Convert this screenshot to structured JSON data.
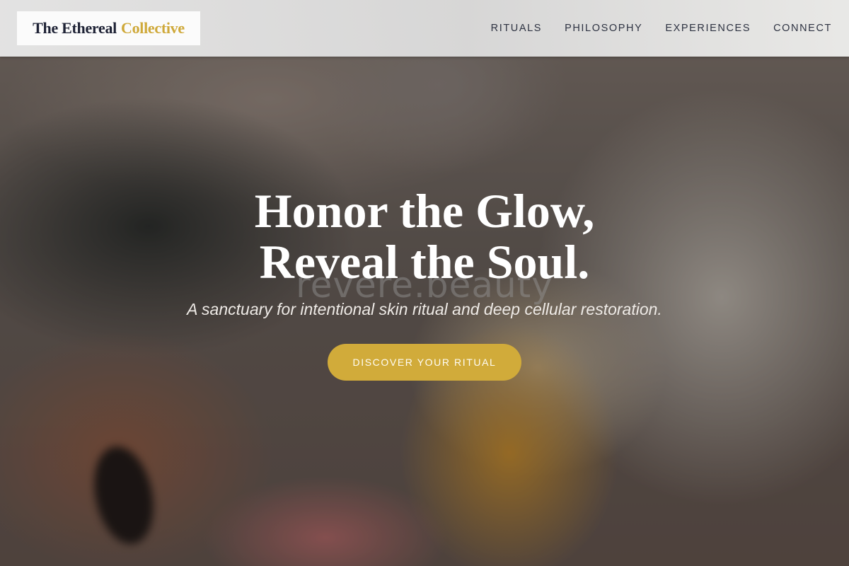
{
  "brand": {
    "name_part1": "The Ethereal",
    "name_part2": "Collective",
    "colors": {
      "navy": "#1e2235",
      "gold": "#cfa93a"
    }
  },
  "nav": {
    "items": [
      {
        "label": "RITUALS"
      },
      {
        "label": "PHILOSOPHY"
      },
      {
        "label": "EXPERIENCES"
      },
      {
        "label": "CONNECT"
      }
    ]
  },
  "hero": {
    "headline_line1": "Honor the Glow,",
    "headline_line2": "Reveal the Soul.",
    "watermark": "revere.beauty",
    "subtitle": "A sanctuary for intentional skin ritual and deep cellular restoration.",
    "cta_label": "DISCOVER YOUR RITUAL",
    "cta_color": "#d1ab3a"
  }
}
